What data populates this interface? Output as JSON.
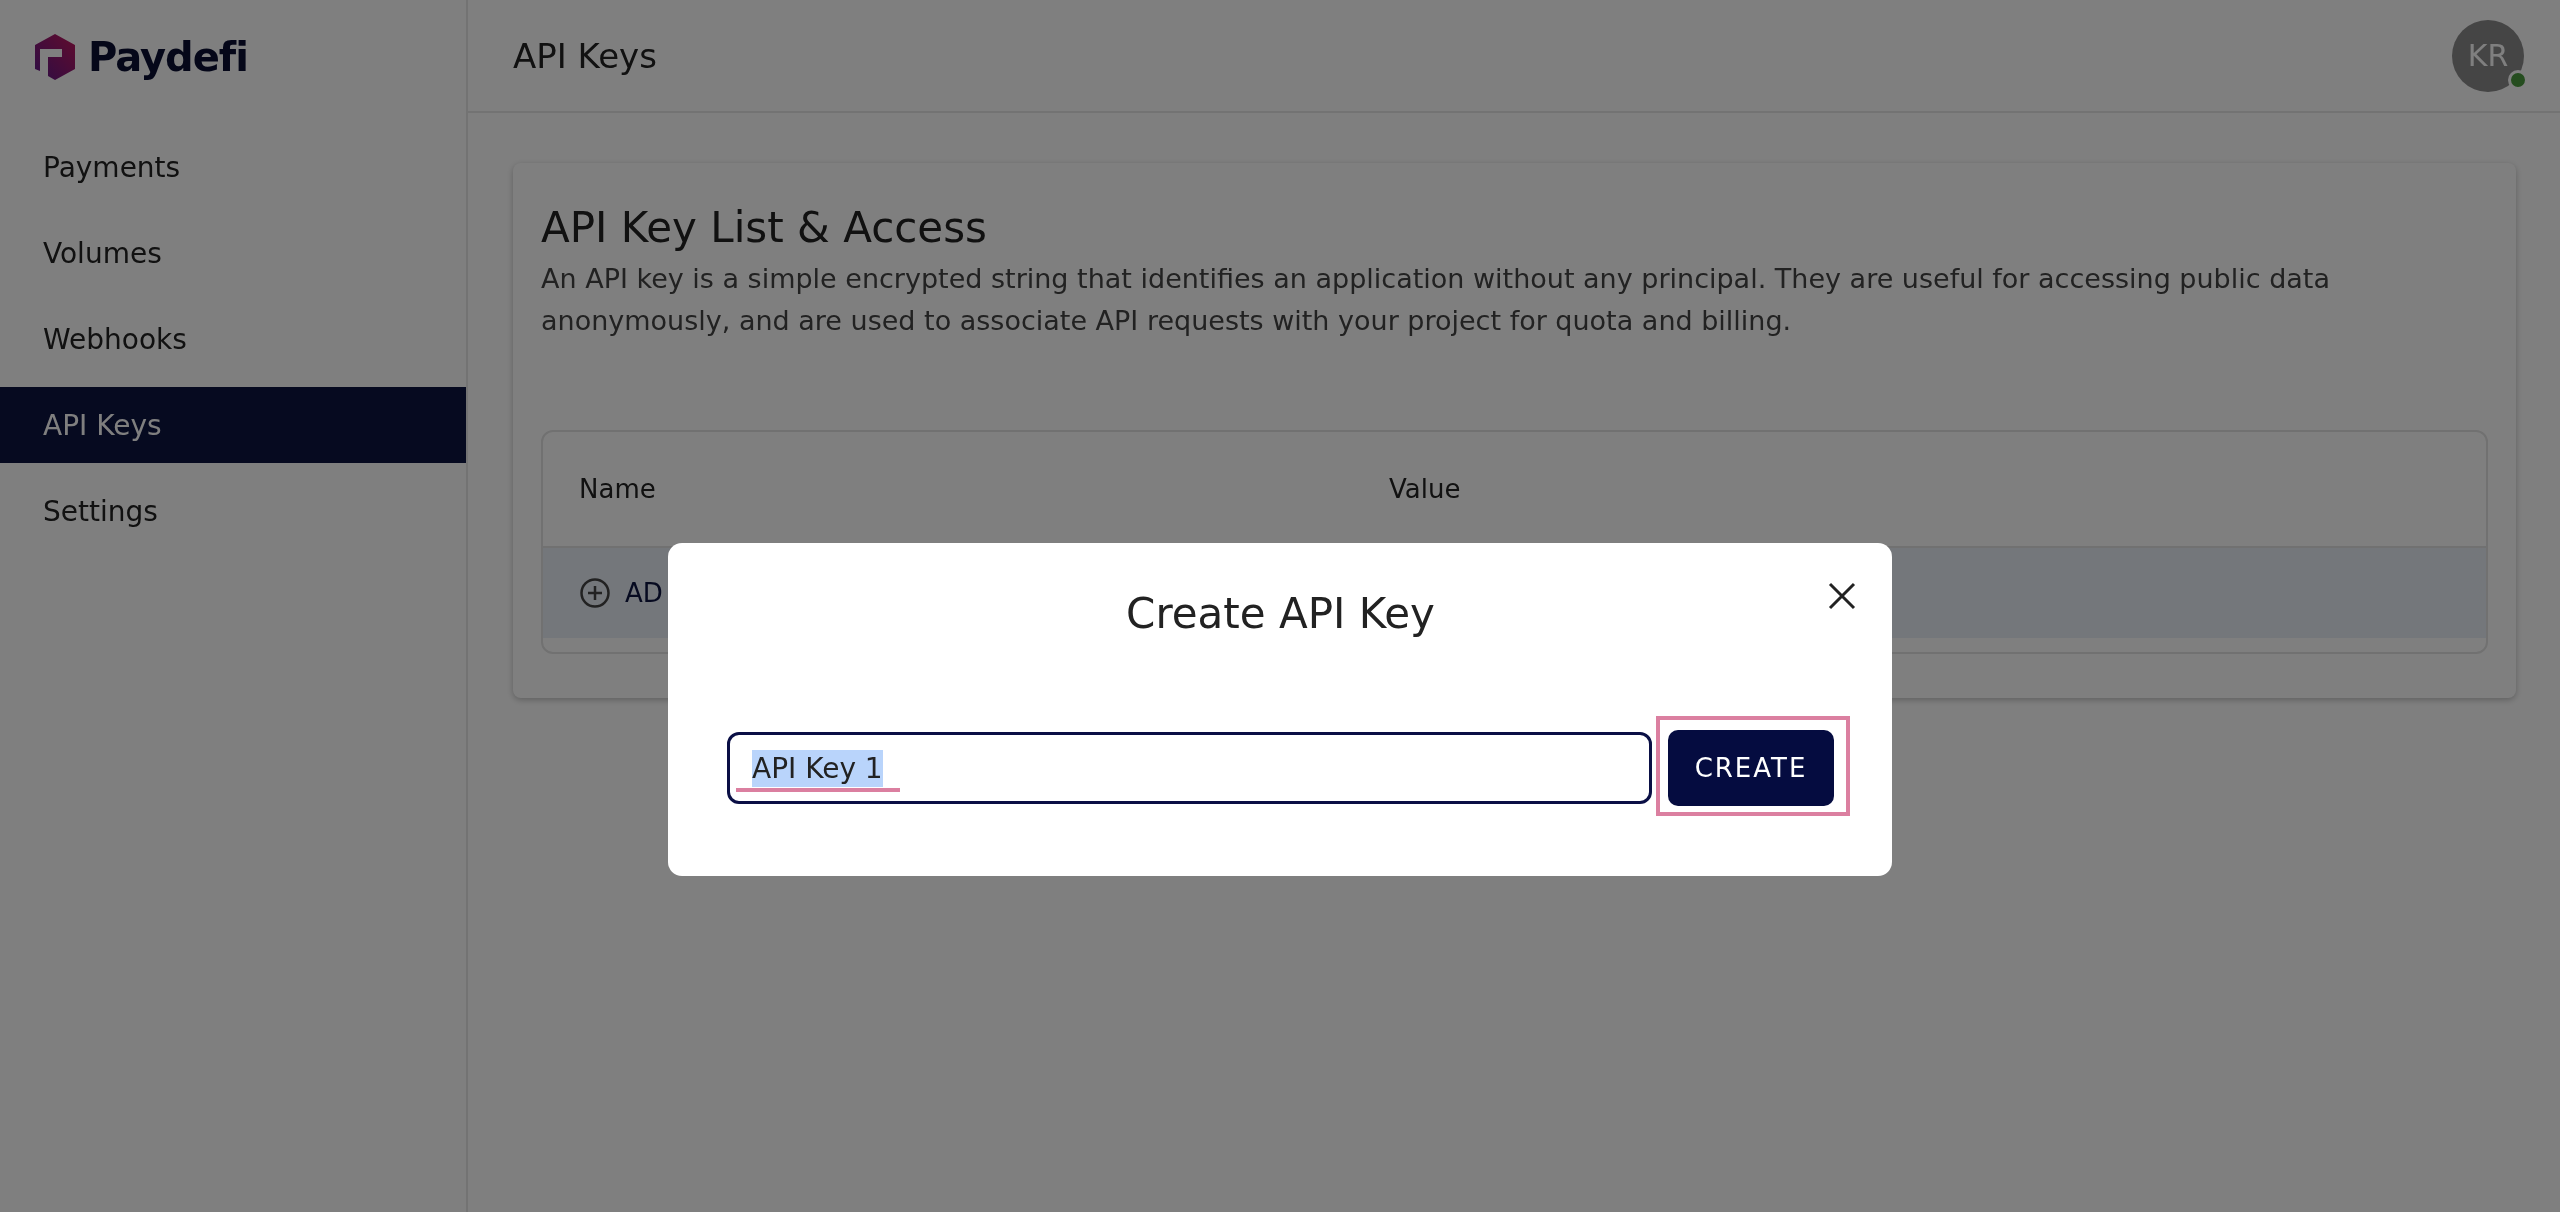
{
  "sidebar": {
    "logo": "Paydefi",
    "items": [
      {
        "label": "Payments",
        "selected": false
      },
      {
        "label": "Volumes",
        "selected": false
      },
      {
        "label": "Webhooks",
        "selected": false
      },
      {
        "label": "API Keys",
        "selected": true
      },
      {
        "label": "Settings",
        "selected": false
      }
    ]
  },
  "header": {
    "title": "API Keys",
    "avatar": "KR",
    "online": true
  },
  "card": {
    "title": "API Key List & Access",
    "description": "An API key is a simple encrypted string that identifies an application without any principal. They are useful for accessing public data anonymously, and are used to associate API requests with your project for quota and billing."
  },
  "table": {
    "columns": [
      "Name",
      "Value"
    ],
    "add_label": "AD"
  },
  "modal": {
    "title": "Create API Key",
    "value": "API Key 1",
    "text_selected": true,
    "button": "CREATE"
  }
}
